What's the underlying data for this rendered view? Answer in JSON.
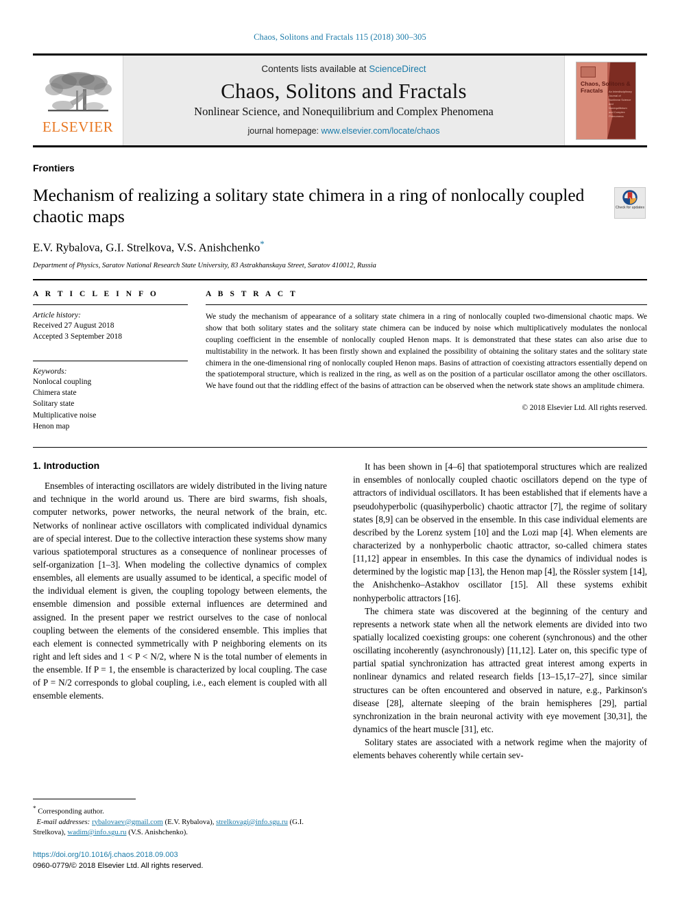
{
  "running_head": "Chaos, Solitons and Fractals 115 (2018) 300–305",
  "masthead": {
    "contents_prefix": "Contents lists available at",
    "contents_link": "ScienceDirect",
    "journal_title": "Chaos, Solitons and Fractals",
    "journal_subtitle": "Nonlinear Science, and Nonequilibrium and Complex Phenomena",
    "homepage_prefix": "journal homepage:",
    "homepage_link": "www.elsevier.com/locate/chaos",
    "publisher": "ELSEVIER",
    "cover_title": "Chaos, Solitons & Fractals",
    "cover_subtitle": "An Interdisciplinary Journal of Nonlinear Science and Nonequilibrium and Complex Phenomena"
  },
  "article": {
    "section_label": "Frontiers",
    "title": "Mechanism of realizing a solitary state chimera in a ring of nonlocally coupled chaotic maps",
    "authors": "E.V. Rybalova, G.I. Strelkova, V.S. Anishchenko",
    "affiliation": "Department of Physics, Saratov National Research State University, 83 Astrakhanskaya Street, Saratov 410012, Russia",
    "crossmark_label": "Check for updates"
  },
  "info": {
    "heading": "A R T I C L E  I N F O",
    "history_label": "Article history:",
    "history": [
      "Received 27 August 2018",
      "Accepted 3 September 2018"
    ],
    "keywords_label": "Keywords:",
    "keywords": [
      "Nonlocal coupling",
      "Chimera state",
      "Solitary state",
      "Multiplicative noise",
      "Henon map"
    ]
  },
  "abstract": {
    "heading": "A B S T R A C T",
    "text": "We study the mechanism of appearance of a solitary state chimera in a ring of nonlocally coupled two-dimensional chaotic maps. We show that both solitary states and the solitary state chimera can be induced by noise which multiplicatively modulates the nonlocal coupling coefficient in the ensemble of nonlocally coupled Henon maps. It is demonstrated that these states can also arise due to multistability in the network. It has been firstly shown and explained the possibility of obtaining the solitary states and the solitary state chimera in the one-dimensional ring of nonlocally coupled Henon maps. Basins of attraction of coexisting attractors essentially depend on the spatiotemporal structure, which is realized in the ring, as well as on the position of a particular oscillator among the other oscillators. We have found out that the riddling effect of the basins of attraction can be observed when the network state shows an amplitude chimera.",
    "copyright": "© 2018 Elsevier Ltd. All rights reserved."
  },
  "body": {
    "section_number_title": "1. Introduction",
    "left_paragraphs": [
      "Ensembles of interacting oscillators are widely distributed in the living nature and technique in the world around us. There are bird swarms, fish shoals, computer networks, power networks, the neural network of the brain, etc. Networks of nonlinear active oscillators with complicated individual dynamics are of special interest. Due to the collective interaction these systems show many various spatiotemporal structures as a consequence of nonlinear processes of self-organization [1–3]. When modeling the collective dynamics of complex ensembles, all elements are usually assumed to be identical, a specific model of the individual element is given, the coupling topology between elements, the ensemble dimension and possible external influences are determined and assigned. In the present paper we restrict ourselves to the case of nonlocal coupling between the elements of the considered ensemble. This implies that each element is connected symmetrically with P neighboring elements on its right and left sides and 1 < P < N/2, where N is the total number of elements in the ensemble. If P = 1, the ensemble is characterized by local coupling. The case of P = N/2 corresponds to global coupling, i.e., each element is coupled with all ensemble elements."
    ],
    "right_paragraphs": [
      "It has been shown in [4–6] that spatiotemporal structures which are realized in ensembles of nonlocally coupled chaotic oscillators depend on the type of attractors of individual oscillators. It has been established that if elements have a pseudohyperbolic (quasihyperbolic) chaotic attractor [7], the regime of solitary states [8,9] can be observed in the ensemble. In this case individual elements are described by the Lorenz system [10] and the Lozi map [4]. When elements are characterized by a nonhyperbolic chaotic attractor, so-called chimera states [11,12] appear in ensembles. In this case the dynamics of individual nodes is determined by the logistic map [13], the Henon map [4], the Rössler system [14], the Anishchenko–Astakhov oscillator [15]. All these systems exhibit nonhyperbolic attractors [16].",
      "The chimera state was discovered at the beginning of the century and represents a network state when all the network elements are divided into two spatially localized coexisting groups: one coherent (synchronous) and the other oscillating incoherently (asynchronously) [11,12]. Later on, this specific type of partial spatial synchronization has attracted great interest among experts in nonlinear dynamics and related research fields [13–15,17–27], since similar structures can be often encountered and observed in nature, e.g., Parkinson's disease [28], alternate sleeping of the brain hemispheres [29], partial synchronization in the brain neuronal activity with eye movement [30,31], the dynamics of the heart muscle [31], etc.",
      "Solitary states are associated with a network regime when the majority of elements behaves coherently while certain sev-"
    ]
  },
  "footnote": {
    "corresponding": "Corresponding author.",
    "email_label": "E-mail addresses:",
    "emails": [
      {
        "address": "rybalovaev@gmail.com",
        "person": "(E.V. Rybalova)"
      },
      {
        "address": "strelkovagi@info.sgu.ru",
        "person": "(G.I. Strelkova)"
      },
      {
        "address": "wadim@info.sgu.ru",
        "person": "(V.S. Anishchenko)"
      }
    ],
    "doi": "https://doi.org/10.1016/j.chaos.2018.09.003",
    "issn": "0960-0779/© 2018 Elsevier Ltd. All rights reserved."
  },
  "colors": {
    "link": "#1a7aa8",
    "elsevier_orange": "#E87722",
    "masthead_bg": "#ebebeb"
  }
}
